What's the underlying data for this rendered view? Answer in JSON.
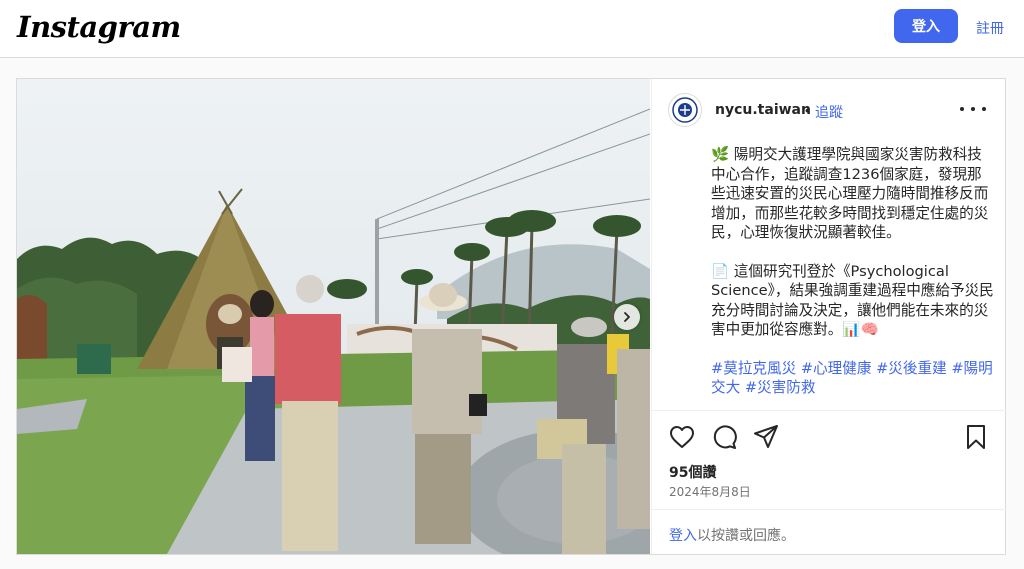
{
  "header": {
    "logo": "Instagram",
    "login_label": "登入",
    "signup_label": "註冊"
  },
  "post": {
    "username": "nycu.taiwan",
    "dot": "•",
    "follow_label": "追蹤",
    "caption_p1": "🌿 陽明交大護理學院與國家災害防救科技中心合作，追蹤調查1236個家庭，發現那些迅速安置的災民心理壓力隨時間推移反而增加，而那些花較多時間找到穩定住處的災民，心理恢復狀況顯著較佳。",
    "caption_p2": "📄 這個研究刊登於《Psychological Science》，結果強調重建過程中應給予災民充分時間討論及決定，讓他們能在未來的災害中更加從容應對。📊🧠",
    "hashtags": "#莫拉克風災 #心理健康 #災後重建 #陽明交大 #災害防救",
    "likes": "95個讚",
    "date": "2024年8月8日",
    "login_link": "登入",
    "login_prompt_rest": "以按讚或回應。"
  },
  "colors": {
    "accent": "#4267ef",
    "border": "#dbdbdb",
    "muted": "#737373"
  },
  "icons": [
    "heart-icon",
    "comment-icon",
    "share-icon",
    "bookmark-icon",
    "more-options-icon",
    "chevron-right-icon"
  ]
}
